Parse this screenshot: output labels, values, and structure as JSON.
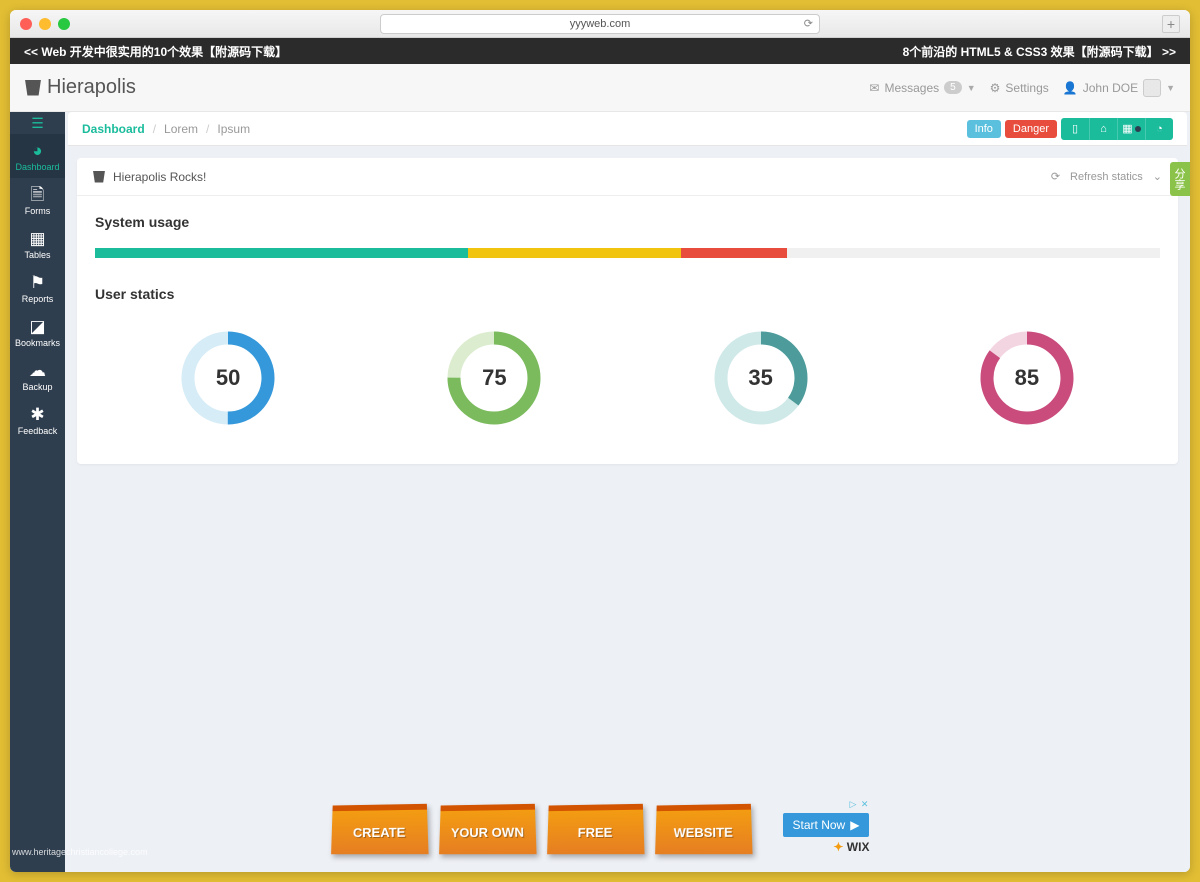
{
  "browser": {
    "url": "yyyweb.com"
  },
  "banner": {
    "left": "<< Web 开发中很实用的10个效果【附源码下载】",
    "right": "8个前沿的 HTML5 & CSS3 效果【附源码下载】 >>"
  },
  "header": {
    "brand": "Hierapolis",
    "messages_label": "Messages",
    "messages_count": "5",
    "settings_label": "Settings",
    "user_name": "John DOE"
  },
  "sidebar": {
    "items": [
      {
        "label": "Dashboard",
        "icon": "⚡"
      },
      {
        "label": "Forms",
        "icon": "📄"
      },
      {
        "label": "Tables",
        "icon": "▦"
      },
      {
        "label": "Reports",
        "icon": "⚑"
      },
      {
        "label": "Bookmarks",
        "icon": "🔖"
      },
      {
        "label": "Backup",
        "icon": "☁"
      },
      {
        "label": "Feedback",
        "icon": "🐞"
      }
    ]
  },
  "breadcrumb": {
    "items": [
      "Dashboard",
      "Lorem",
      "Ipsum"
    ],
    "info_label": "Info",
    "danger_label": "Danger"
  },
  "panel": {
    "title": "Hierapolis Rocks!",
    "refresh_label": "Refresh statics",
    "section1_title": "System usage",
    "section2_title": "User statics"
  },
  "progress": [
    {
      "width": 35,
      "color": "#1abc9c"
    },
    {
      "width": 20,
      "color": "#f1c40f"
    },
    {
      "width": 10,
      "color": "#e74c3c"
    }
  ],
  "chart_data": {
    "type": "pie",
    "title": "User statics",
    "series": [
      {
        "name": "donut-1",
        "value": 50,
        "max": 100,
        "color": "#3498db",
        "track": "#d6ecf7"
      },
      {
        "name": "donut-2",
        "value": 75,
        "max": 100,
        "color": "#7bbb5e",
        "track": "#dceccf"
      },
      {
        "name": "donut-3",
        "value": 35,
        "max": 100,
        "color": "#4d9b9b",
        "track": "#cfe8e8"
      },
      {
        "name": "donut-4",
        "value": 85,
        "max": 100,
        "color": "#c94c7c",
        "track": "#f3d5e1"
      }
    ]
  },
  "share_tab": "分享",
  "ads": {
    "cards": [
      "CREATE",
      "YOUR OWN",
      "FREE",
      "WEBSITE"
    ],
    "button": "Start Now",
    "brand": "WIX",
    "marker": "▷ ✕"
  },
  "footer_url": "www.heritagechristiancollege.com"
}
